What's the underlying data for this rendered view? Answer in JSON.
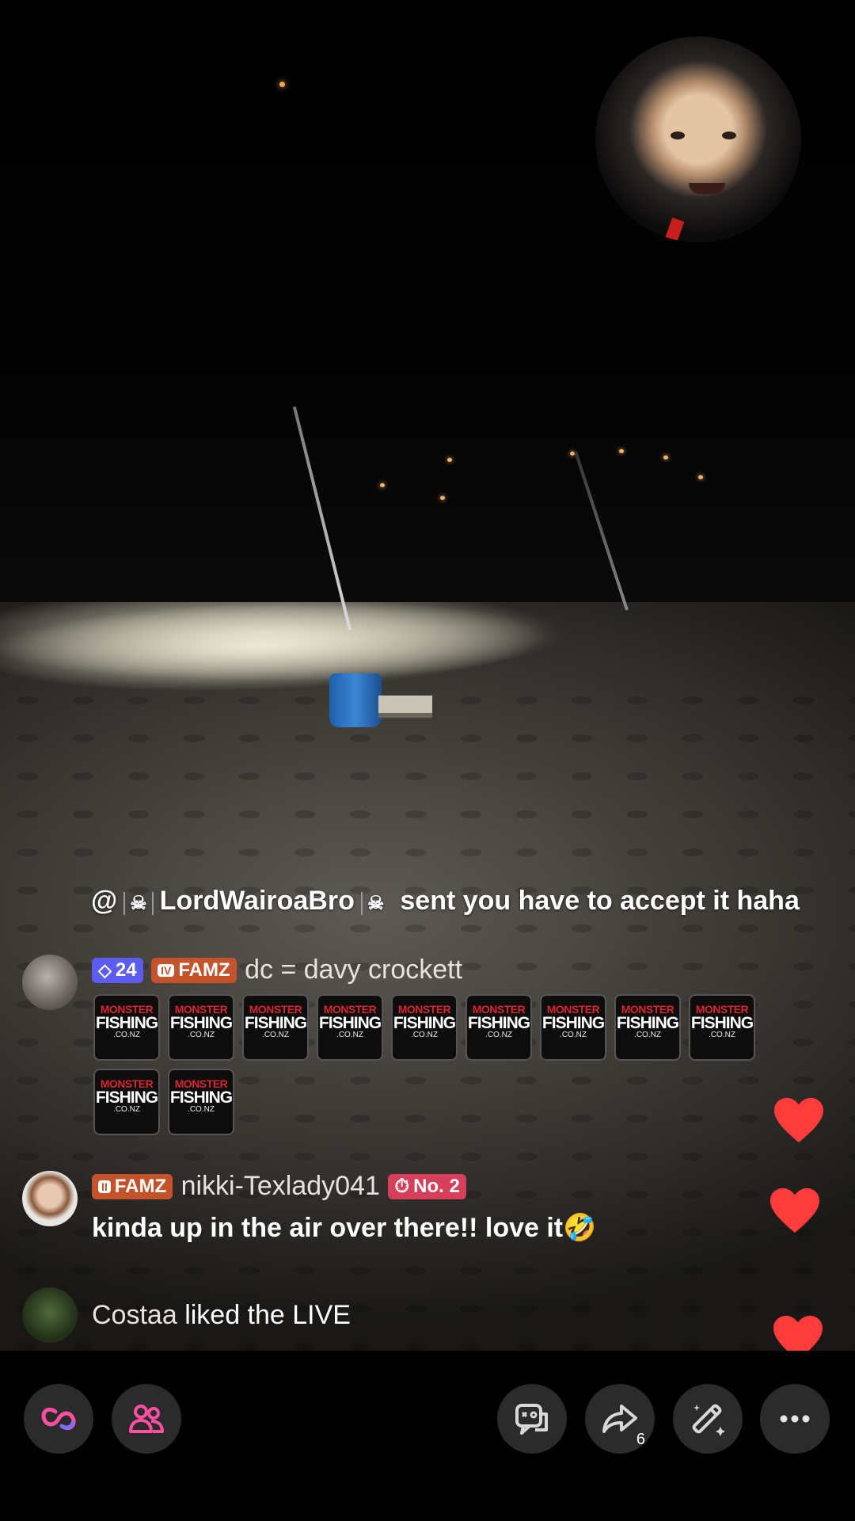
{
  "top_message": {
    "mention": "@",
    "user": "LordWairoaBro",
    "text": "sent you have to accept it haha"
  },
  "comment1": {
    "level": "24",
    "fan_level": "IV",
    "fan_label": "FAMZ",
    "username": "dc = davy crockett",
    "sticker": {
      "line1": "MONSTER",
      "line2": "FISHING",
      "line3": ".CO.NZ"
    },
    "sticker_count": 11
  },
  "comment2": {
    "fan_level": "II",
    "fan_label": "FAMZ",
    "username": "nikki-Texlady041",
    "rank_label": "No. 2",
    "text": "kinda up in the air over there!! love it🤣"
  },
  "comment3": {
    "username": "Costaa",
    "text": "liked the LIVE"
  },
  "bottom_bar": {
    "share_count": "6"
  },
  "colors": {
    "heart": "#ff3b3b",
    "accent_pink": "#ff3e7f",
    "accent_blue": "#25f4ee"
  }
}
